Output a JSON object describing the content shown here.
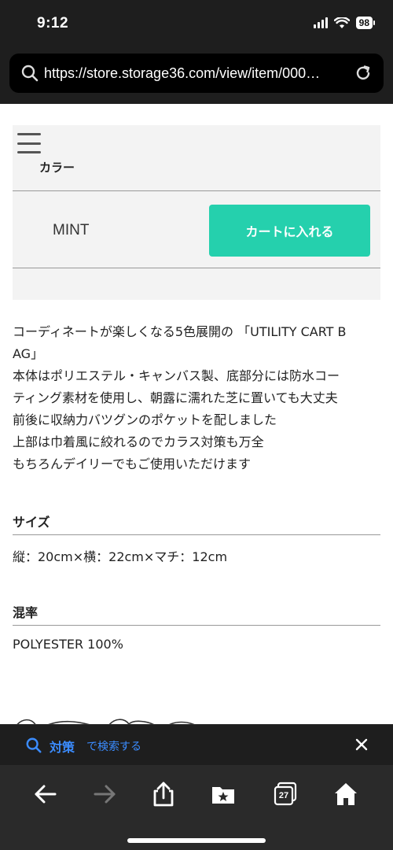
{
  "status_bar": {
    "time": "9:12",
    "battery": "98"
  },
  "browser": {
    "url": "https://store.storage36.com/view/item/000…"
  },
  "product": {
    "color_label": "カラー",
    "color_value": "MINT",
    "cart_button_label": "カートに入れる",
    "accent_color": "#25d0ad",
    "description_lines": [
      "コーディネートが楽しくなる5色展開の 「UTILITY CART B",
      "AG」",
      "本体はポリエステル・キャンバス製、底部分には防水コー",
      "ティング素材を使用し、朝露に濡れた芝に置いても大丈夫",
      "前後に収納力バツグンのポケットを配しました",
      "上部は巾着風に絞れるのでカラス対策も万全",
      "もちろんデイリーでもご使用いただけます"
    ],
    "size_title": "サイズ",
    "size_value": "縦：20cm×横：22cm×マチ：12cm",
    "material_title": "混率",
    "material_value": "POLYESTER 100%"
  },
  "find_bar": {
    "query": "対策",
    "suffix": "で検索する",
    "color": "#3b8cff"
  },
  "toolbar": {
    "tab_count": "27",
    "icons": [
      "back-icon",
      "forward-icon",
      "share-icon",
      "bookmarks-icon",
      "tabs-icon",
      "home-icon"
    ]
  }
}
